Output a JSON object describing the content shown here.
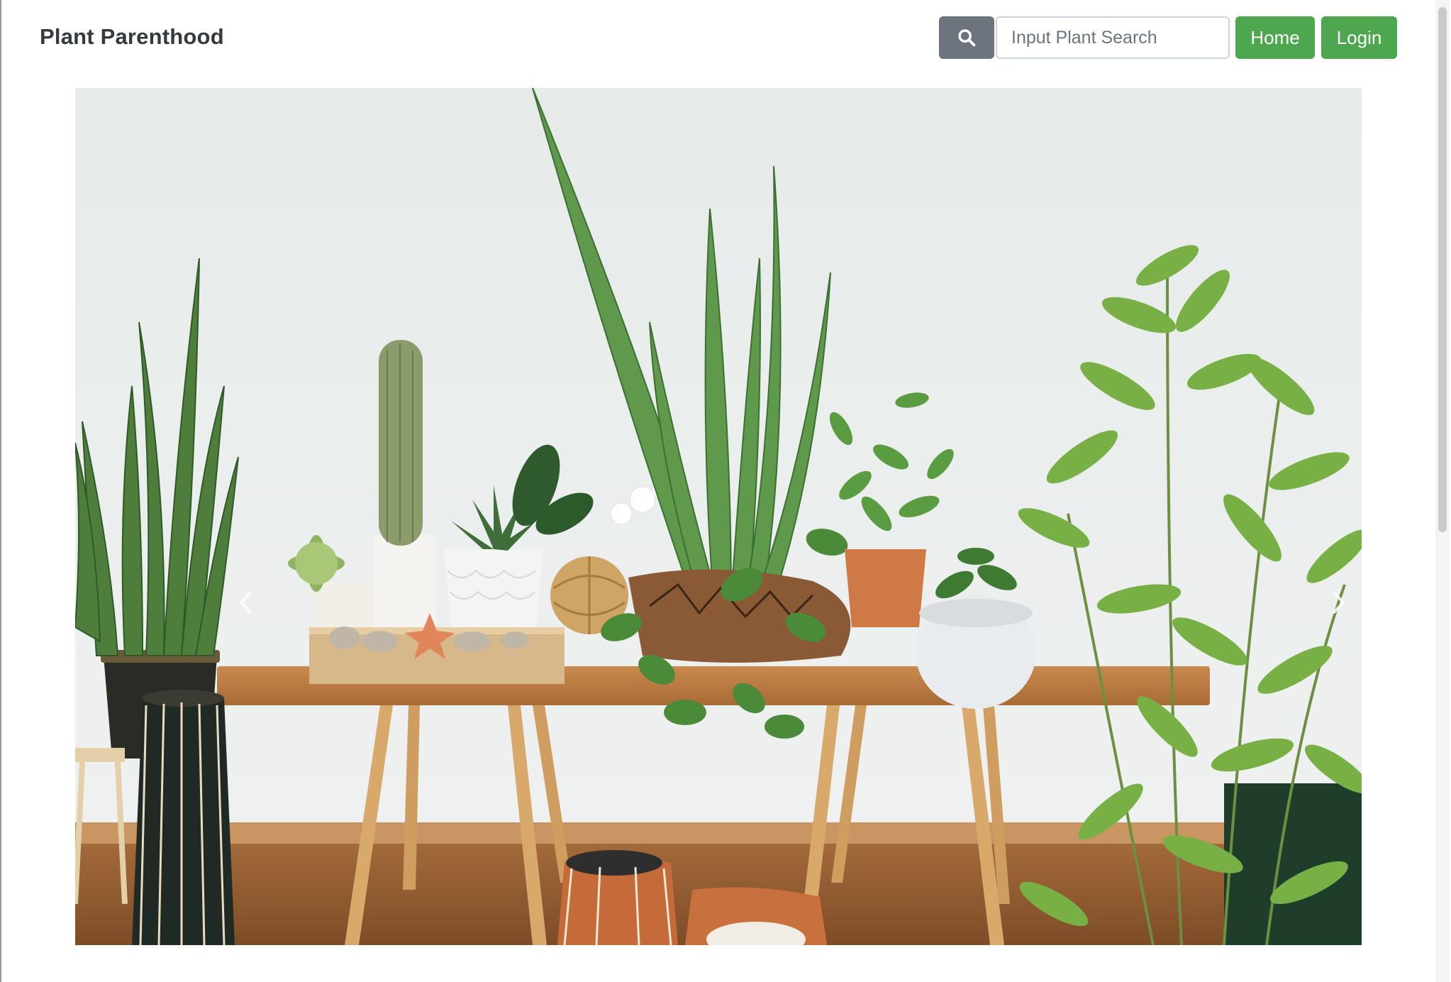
{
  "navbar": {
    "brand": "Plant Parenthood",
    "search": {
      "placeholder": "Input Plant Search",
      "value": "",
      "icon": "search-icon"
    },
    "home_label": "Home",
    "login_label": "Login"
  },
  "carousel": {
    "slide_description_icon": "plant-photo",
    "indicator_count": 4,
    "active_index": 2,
    "prev_icon": "chevron-left-icon",
    "next_icon": "chevron-right-icon"
  },
  "colors": {
    "brand_green": "#4ea64e",
    "search_button": "#6c757d"
  }
}
